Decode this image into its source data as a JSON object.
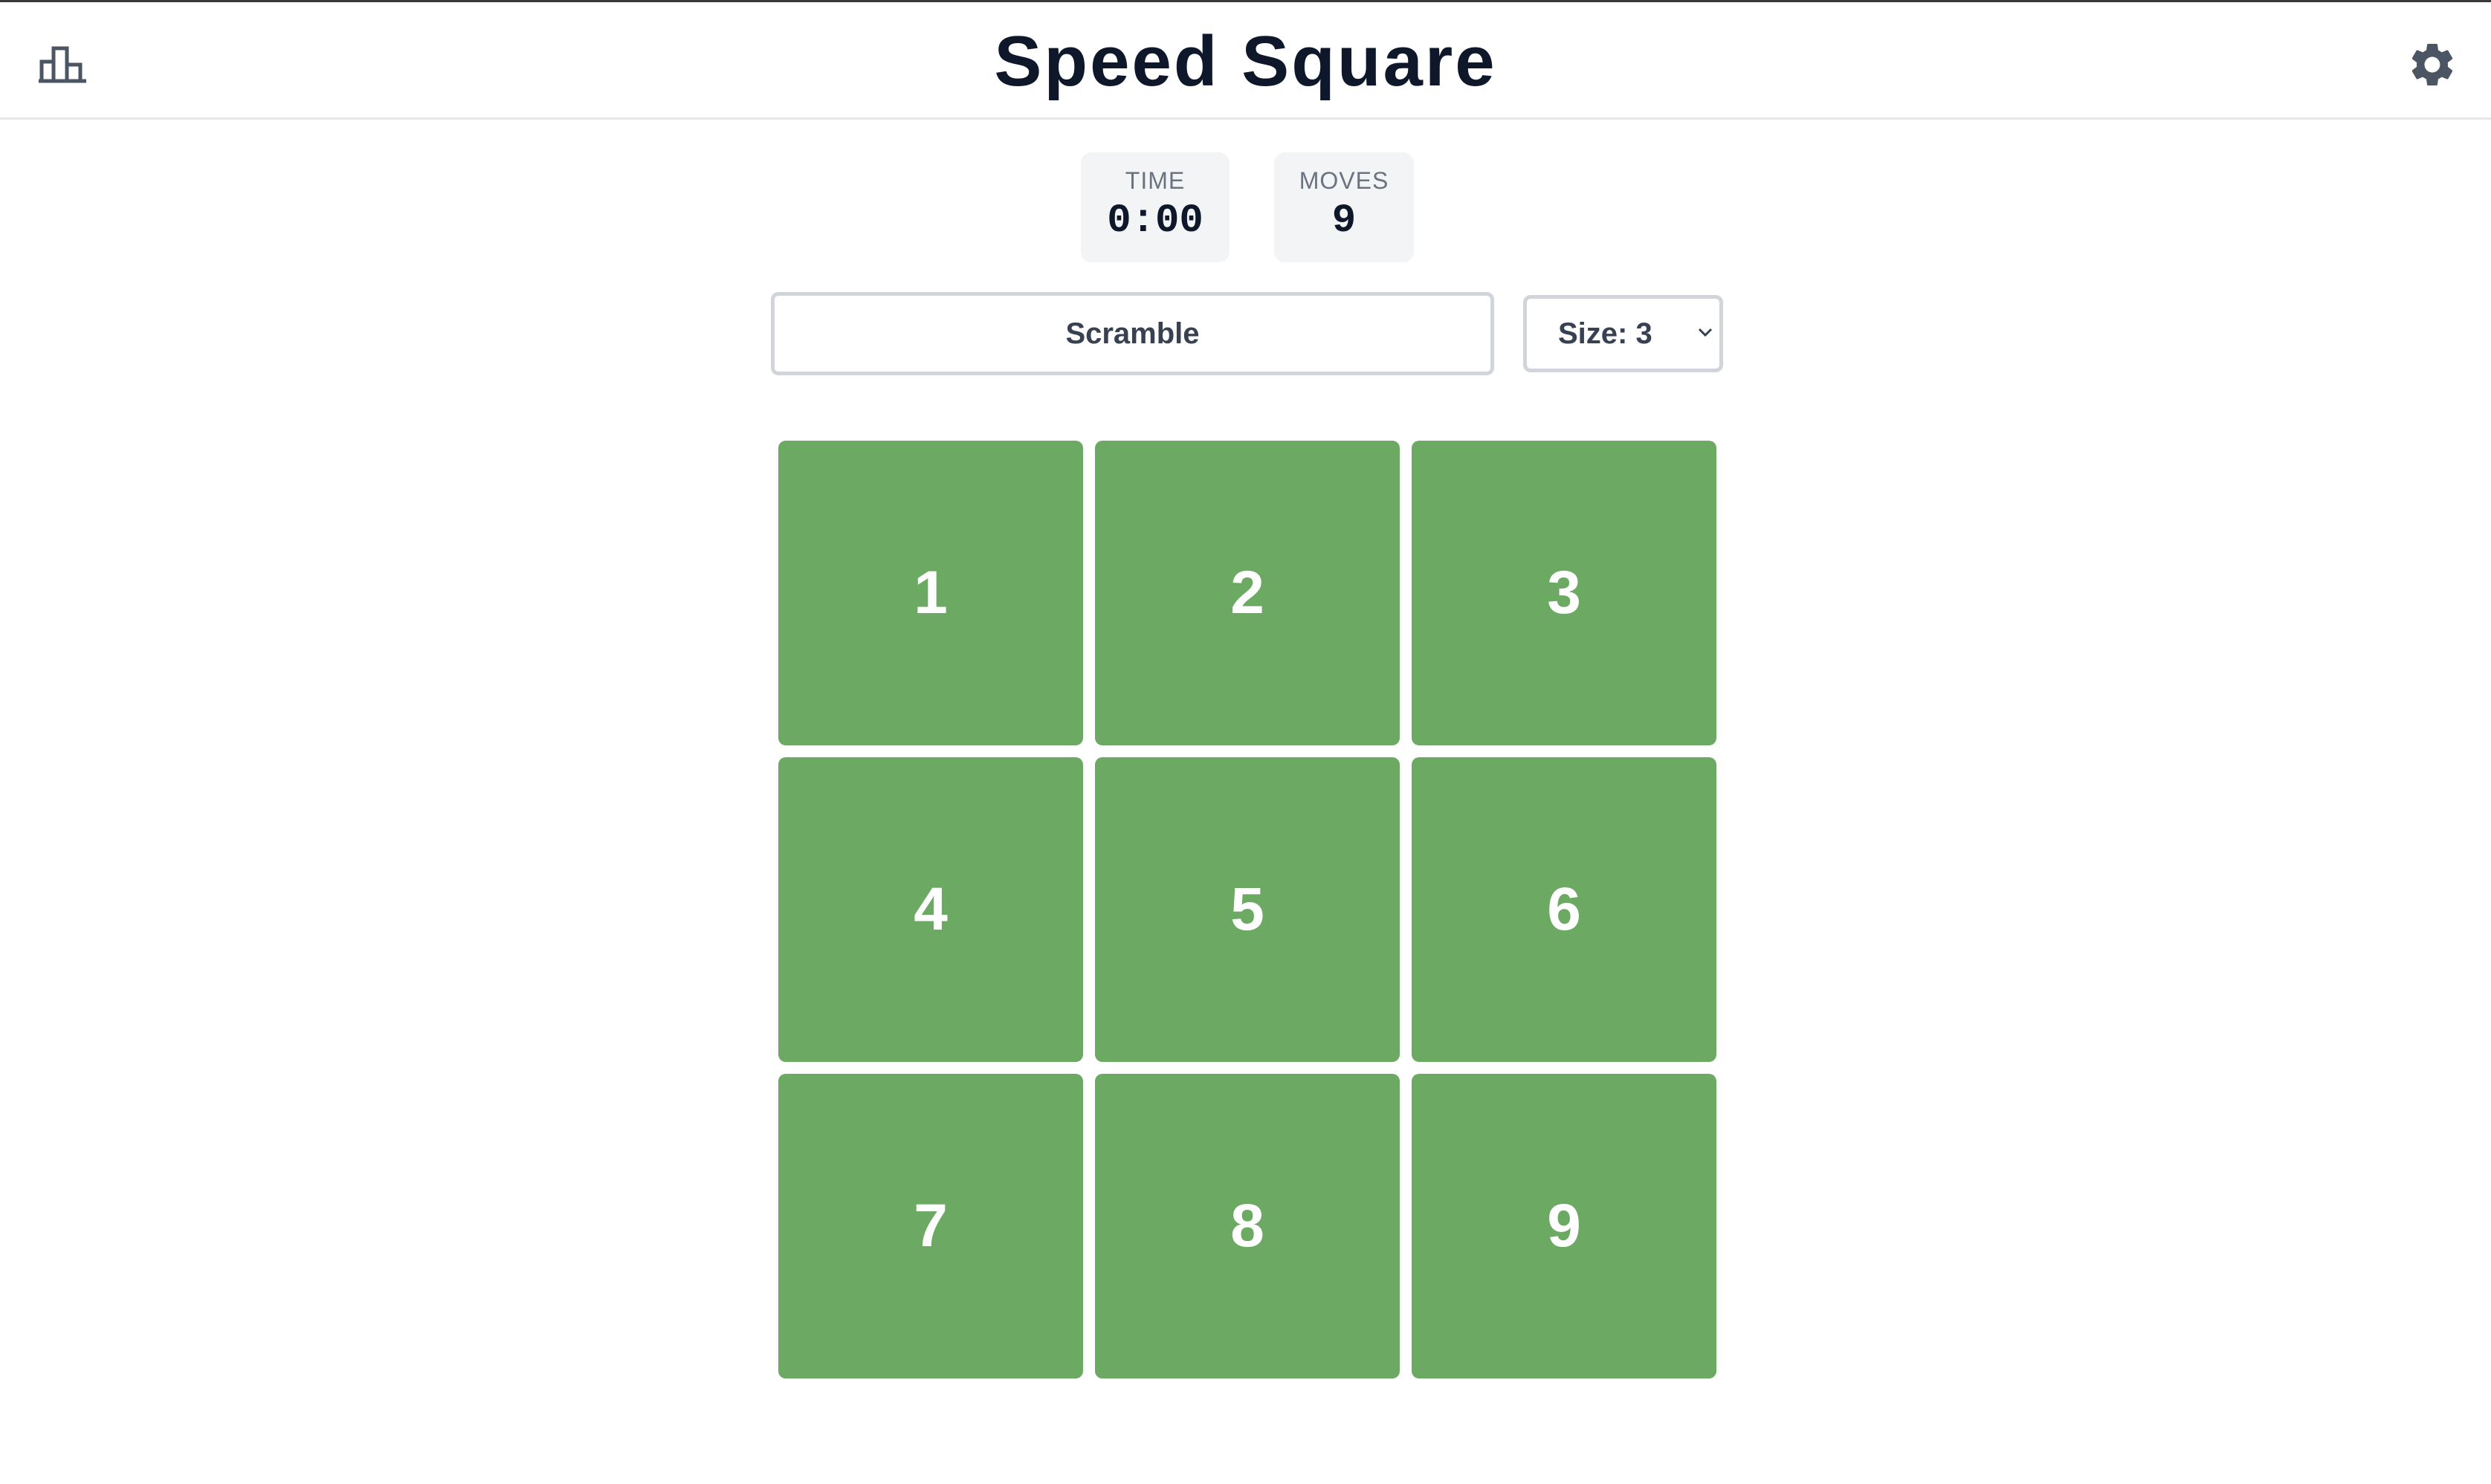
{
  "header": {
    "title": "Speed Square",
    "stats_icon": "bar-chart-icon",
    "settings_icon": "gear-icon"
  },
  "stats": {
    "time_label": "TIME",
    "time_value": "0:00",
    "moves_label": "MOVES",
    "moves_value": "9"
  },
  "controls": {
    "scramble_label": "Scramble",
    "size_label": "Size: 3",
    "size_selected": "3"
  },
  "board": {
    "size": 3,
    "tile_color": "#6caa64",
    "tiles": [
      "1",
      "2",
      "3",
      "4",
      "5",
      "6",
      "7",
      "8",
      "9"
    ]
  }
}
